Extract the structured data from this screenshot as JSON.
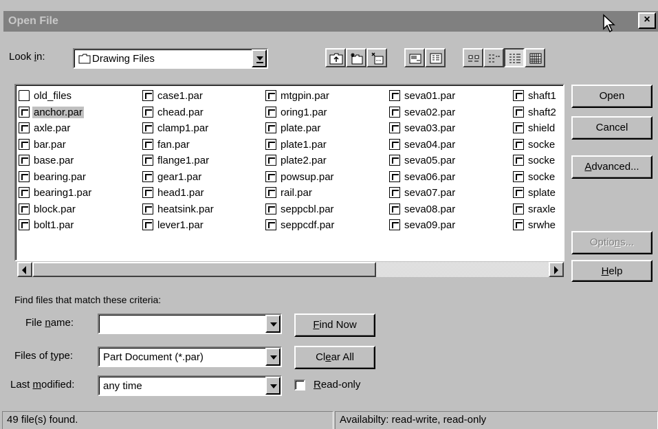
{
  "title": "Open File",
  "close_glyph": "×",
  "look_in": {
    "label_pre": "Look ",
    "label_u": "i",
    "label_post": "n:",
    "value": "Drawing Files"
  },
  "toolbar": {
    "icons": [
      "up-folder-icon",
      "new-folder-icon",
      "delete-icon",
      "properties-icon",
      "details-view-icon",
      "small-icons-icon",
      "list-view-icon",
      "details-list-icon",
      "preview-icon"
    ]
  },
  "files": {
    "columns": [
      [
        "old_files",
        "anchor.par",
        "axle.par",
        "bar.par",
        "base.par",
        "bearing.par",
        "bearing1.par",
        "block.par",
        "bolt1.par"
      ],
      [
        "case1.par",
        "chead.par",
        "clamp1.par",
        "fan.par",
        "flange1.par",
        "gear1.par",
        "head1.par",
        "heatsink.par",
        "lever1.par"
      ],
      [
        "mtgpin.par",
        "oring1.par",
        "plate.par",
        "plate1.par",
        "plate2.par",
        "powsup.par",
        "rail.par",
        "seppcbl.par",
        "seppcdf.par"
      ],
      [
        "seva01.par",
        "seva02.par",
        "seva03.par",
        "seva04.par",
        "seva05.par",
        "seva06.par",
        "seva07.par",
        "seva08.par",
        "seva09.par"
      ],
      [
        "shaft1",
        "shaft2",
        "shield",
        "socke",
        "socke",
        "socke",
        "splate",
        "sraxle",
        "srwhe"
      ]
    ],
    "folder": "old_files",
    "selected": "anchor.par"
  },
  "buttons": {
    "open": "Open",
    "cancel": "Cancel",
    "advanced_u": "A",
    "advanced_rest": "dvanced...",
    "options_pre": "Optio",
    "options_u": "n",
    "options_post": "s...",
    "help_u": "H",
    "help_rest": "elp",
    "find_now_u": "F",
    "find_now_rest": "ind Now",
    "clear_all_pre": "Cl",
    "clear_all_u": "e",
    "clear_all_post": "ar All"
  },
  "criteria": {
    "heading": "Find files that match these criteria:",
    "file_name_pre": "File ",
    "file_name_u": "n",
    "file_name_post": "ame:",
    "file_name_value": "",
    "files_of_type_pre": "Files of ",
    "files_of_type_u": "t",
    "files_of_type_post": "ype:",
    "files_of_type_value": "Part Document (*.par)",
    "last_modified_pre": "Last ",
    "last_modified_u": "m",
    "last_modified_post": "odified:",
    "last_modified_value": "any time",
    "read_only_u": "R",
    "read_only_rest": "ead-only",
    "read_only_checked": false
  },
  "status": {
    "count": "49 file(s) found.",
    "availability": "Availabilty: read-write, read-only"
  }
}
